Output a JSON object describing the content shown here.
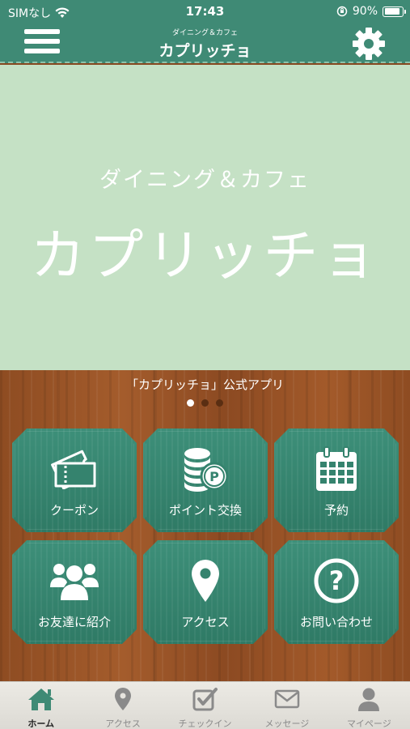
{
  "status": {
    "carrier": "SIMなし",
    "time": "17:43",
    "battery": "90%",
    "battery_level": 0.9
  },
  "nav": {
    "subtitle": "ダイニング＆カフェ",
    "title": "カプリッチョ",
    "menu_icon": "hamburger-icon",
    "settings_icon": "gear-icon"
  },
  "hero": {
    "subtitle": "ダイニング＆カフェ",
    "title": "カプリッチョ",
    "background": "#c5e1c5"
  },
  "banner": {
    "caption": "「カプリッチョ」公式アプリ",
    "page_count": 3,
    "active_page": 1
  },
  "tiles": [
    {
      "label": "クーポン",
      "icon": "ticket-icon"
    },
    {
      "label": "ポイント交換",
      "icon": "coins-icon"
    },
    {
      "label": "予約",
      "icon": "calendar-icon"
    },
    {
      "label": "お友達に紹介",
      "icon": "group-icon"
    },
    {
      "label": "アクセス",
      "icon": "location-pin-icon"
    },
    {
      "label": "お問い合わせ",
      "icon": "question-icon"
    }
  ],
  "tabs": [
    {
      "label": "ホーム",
      "icon": "home-icon",
      "active": true
    },
    {
      "label": "アクセス",
      "icon": "location-pin-icon",
      "active": false
    },
    {
      "label": "チェックイン",
      "icon": "checkin-icon",
      "active": false
    },
    {
      "label": "メッセージ",
      "icon": "mail-icon",
      "active": false
    },
    {
      "label": "マイページ",
      "icon": "user-icon",
      "active": false
    }
  ],
  "colors": {
    "header": "#3f8a75",
    "tile": "#3d8f79",
    "wood": "#9a552a",
    "tab_active": "#3f8a75",
    "tab_inactive": "#8a8a8a"
  }
}
